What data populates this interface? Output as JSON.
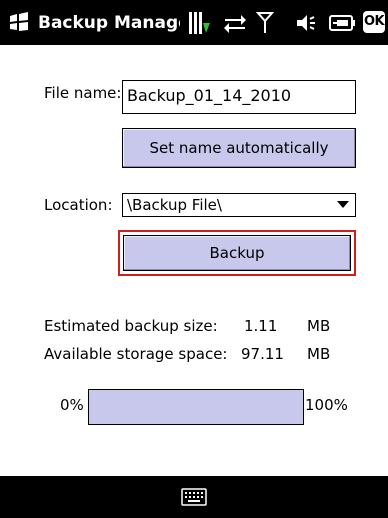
{
  "titlebar": {
    "title": "Backup Manage",
    "ok_label": "OK",
    "icons": [
      "windows-logo-icon",
      "battery-charging-icon",
      "sync-icon",
      "signal-icon",
      "volume-icon",
      "keyboard-battery-icon"
    ]
  },
  "form": {
    "file_name_label": "File name:",
    "file_name_value": "Backup_01_14_2010",
    "set_name_button": "Set name automatically",
    "location_label": "Location:",
    "location_value": "\\Backup File\\",
    "backup_button": "Backup"
  },
  "info": {
    "estimated_label": "Estimated backup size:",
    "estimated_value": "1.11",
    "estimated_unit": "MB",
    "available_label": "Available storage space:",
    "available_value": "97.11",
    "available_unit": "MB"
  },
  "progress": {
    "min_label": "0%",
    "max_label": "100%",
    "value_fraction": 0
  },
  "colors": {
    "button_fill": "#c8c8ec",
    "highlight": "#d41e1e",
    "bar": "#000000"
  }
}
